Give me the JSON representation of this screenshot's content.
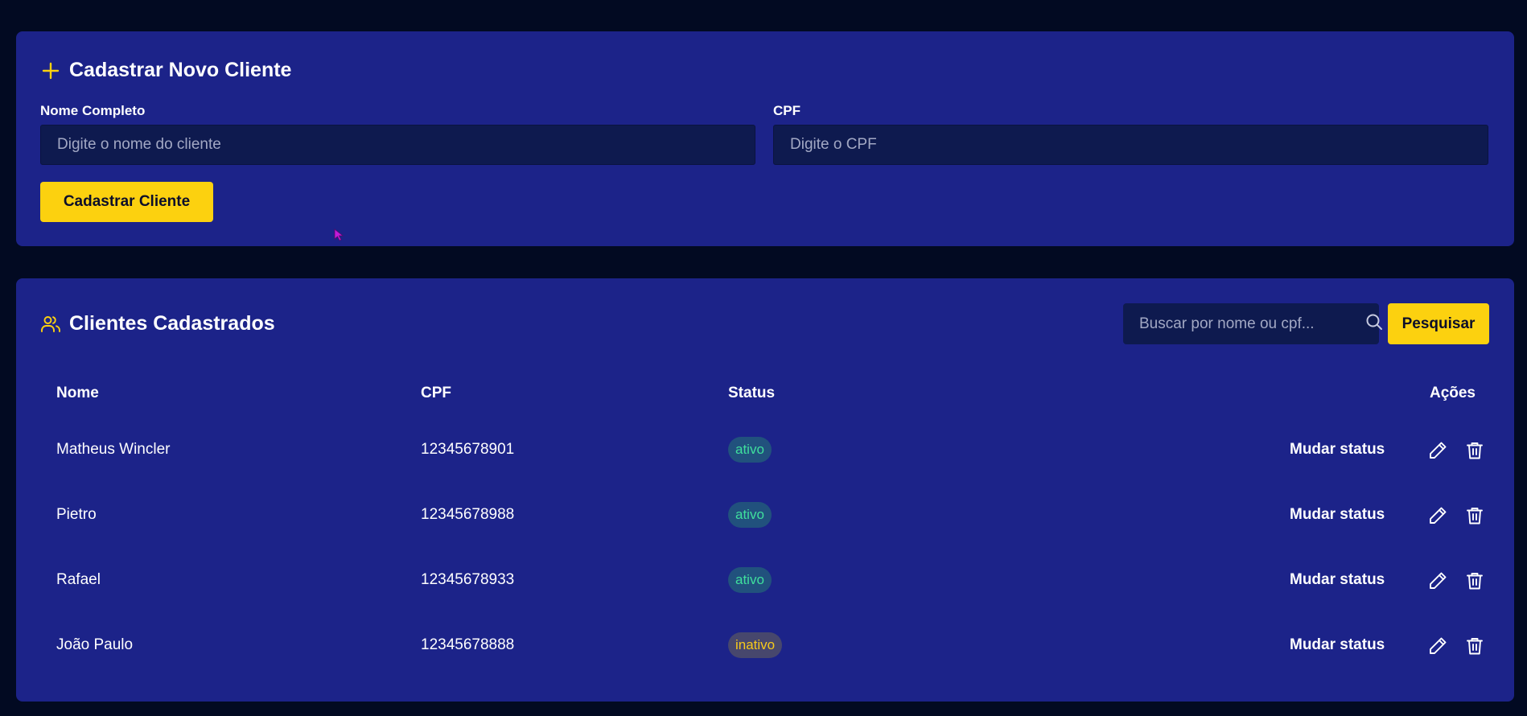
{
  "new_client": {
    "title": "Cadastrar Novo Cliente",
    "title_icon": "plus-icon",
    "name_label": "Nome Completo",
    "name_placeholder": "Digite o nome do cliente",
    "cpf_label": "CPF",
    "cpf_placeholder": "Digite o CPF",
    "submit_label": "Cadastrar Cliente"
  },
  "client_list": {
    "title": "Clientes Cadastrados",
    "title_icon": "users-icon",
    "search_placeholder": "Buscar por nome ou cpf...",
    "search_button": "Pesquisar",
    "columns": {
      "name": "Nome",
      "cpf": "CPF",
      "status": "Status",
      "actions": "Ações"
    },
    "change_status_label": "Mudar status",
    "rows": [
      {
        "name": "Matheus Wincler",
        "cpf": "12345678901",
        "status": "ativo"
      },
      {
        "name": "Pietro",
        "cpf": "12345678988",
        "status": "ativo"
      },
      {
        "name": "Rafael",
        "cpf": "12345678933",
        "status": "ativo"
      },
      {
        "name": "João Paulo",
        "cpf": "12345678888",
        "status": "inativo"
      }
    ]
  },
  "colors": {
    "background": "#020a22",
    "card": "#1c2389",
    "input": "#0e1a4f",
    "accent_yellow": "#fcd10f",
    "status_active_text": "#3fdf9d",
    "status_inactive_text": "#f6c91b"
  }
}
